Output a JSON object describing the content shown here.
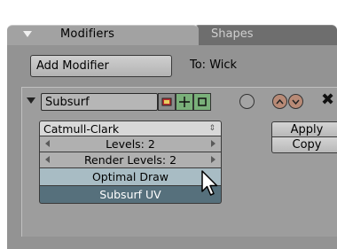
{
  "tabs": {
    "modifiers": "Modifiers",
    "shapes": "Shapes"
  },
  "toolbar": {
    "add_modifier": "Add Modifier",
    "target": "To: Wick"
  },
  "modifier": {
    "name": "Subsurf",
    "subdivision_type": "Catmull-Clark",
    "levels": "Levels: 2",
    "render_levels": "Render Levels: 2",
    "optimal_draw": "Optimal Draw",
    "subsurf_uv": "Subsurf UV",
    "apply": "Apply",
    "copy": "Copy"
  },
  "colors": {
    "panel": "#939393",
    "toggle_active": "#7ab07a",
    "optimal_draw": "#a8bcc4",
    "subsurf_uv": "#56707c",
    "move_buttons": "#b88a76"
  },
  "icons": [
    "collapse-arrow-icon",
    "render-toggle-icon",
    "realtime-toggle-icon",
    "editmode-toggle-icon",
    "cage-circle-icon",
    "move-up-icon",
    "move-down-icon",
    "delete-icon",
    "mouse-cursor-icon"
  ]
}
